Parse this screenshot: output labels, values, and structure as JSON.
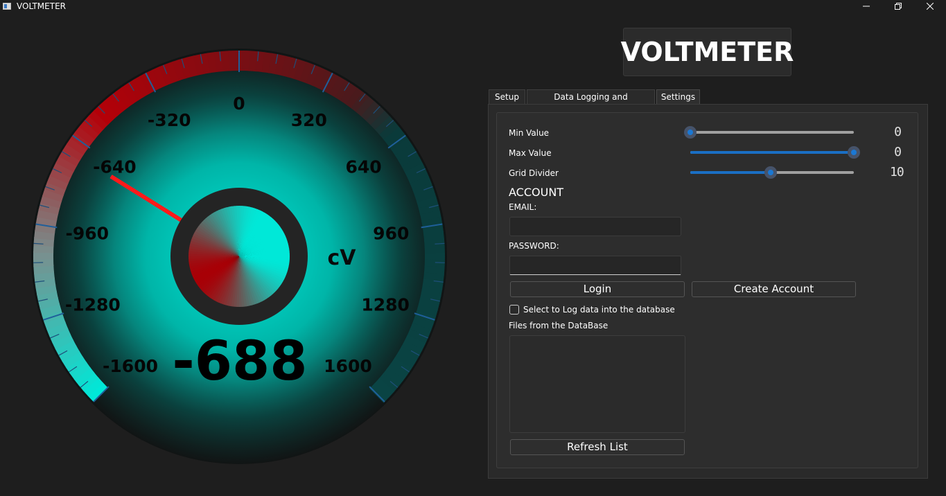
{
  "window": {
    "title": "VOLTMETER",
    "minimize_icon": "minimize-icon",
    "restore_icon": "restore-icon",
    "close_icon": "close-icon"
  },
  "gauge": {
    "value": -688,
    "display_value": "-688",
    "unit": "cV",
    "min": -1600,
    "max": 1600,
    "scale_labels": [
      "-1600",
      "-1280",
      "-960",
      "-640",
      "-320",
      "0",
      "320",
      "640",
      "960",
      "1280",
      "1600"
    ],
    "colors": {
      "needle": "#ff1a1a",
      "cyan": "#00e8d8",
      "red": "#a80006",
      "inner_ring": "#242424"
    }
  },
  "header": {
    "title": "VOLTMETER"
  },
  "tabs": [
    {
      "label": "Setup",
      "active": false
    },
    {
      "label": "Data Logging and Visualization",
      "active": false
    },
    {
      "label": "Settings",
      "active": true
    }
  ],
  "settings": {
    "min_value": {
      "label": "Min Value",
      "display": "0",
      "position": 0.0
    },
    "max_value": {
      "label": "Max Value",
      "display": "0",
      "position": 1.0
    },
    "grid_divider": {
      "label": "Grid Divider",
      "display": "10",
      "position": 0.49
    }
  },
  "account": {
    "heading": "ACCOUNT",
    "email_label": "EMAIL:",
    "email_value": "",
    "password_label": "PASSWORD:",
    "password_value": "",
    "login_label": "Login",
    "create_label": "Create Account",
    "log_checkbox_label": "Select to Log data into the database",
    "log_checked": false,
    "files_label": "Files from the DataBase",
    "files": [],
    "refresh_label": "Refresh List"
  }
}
